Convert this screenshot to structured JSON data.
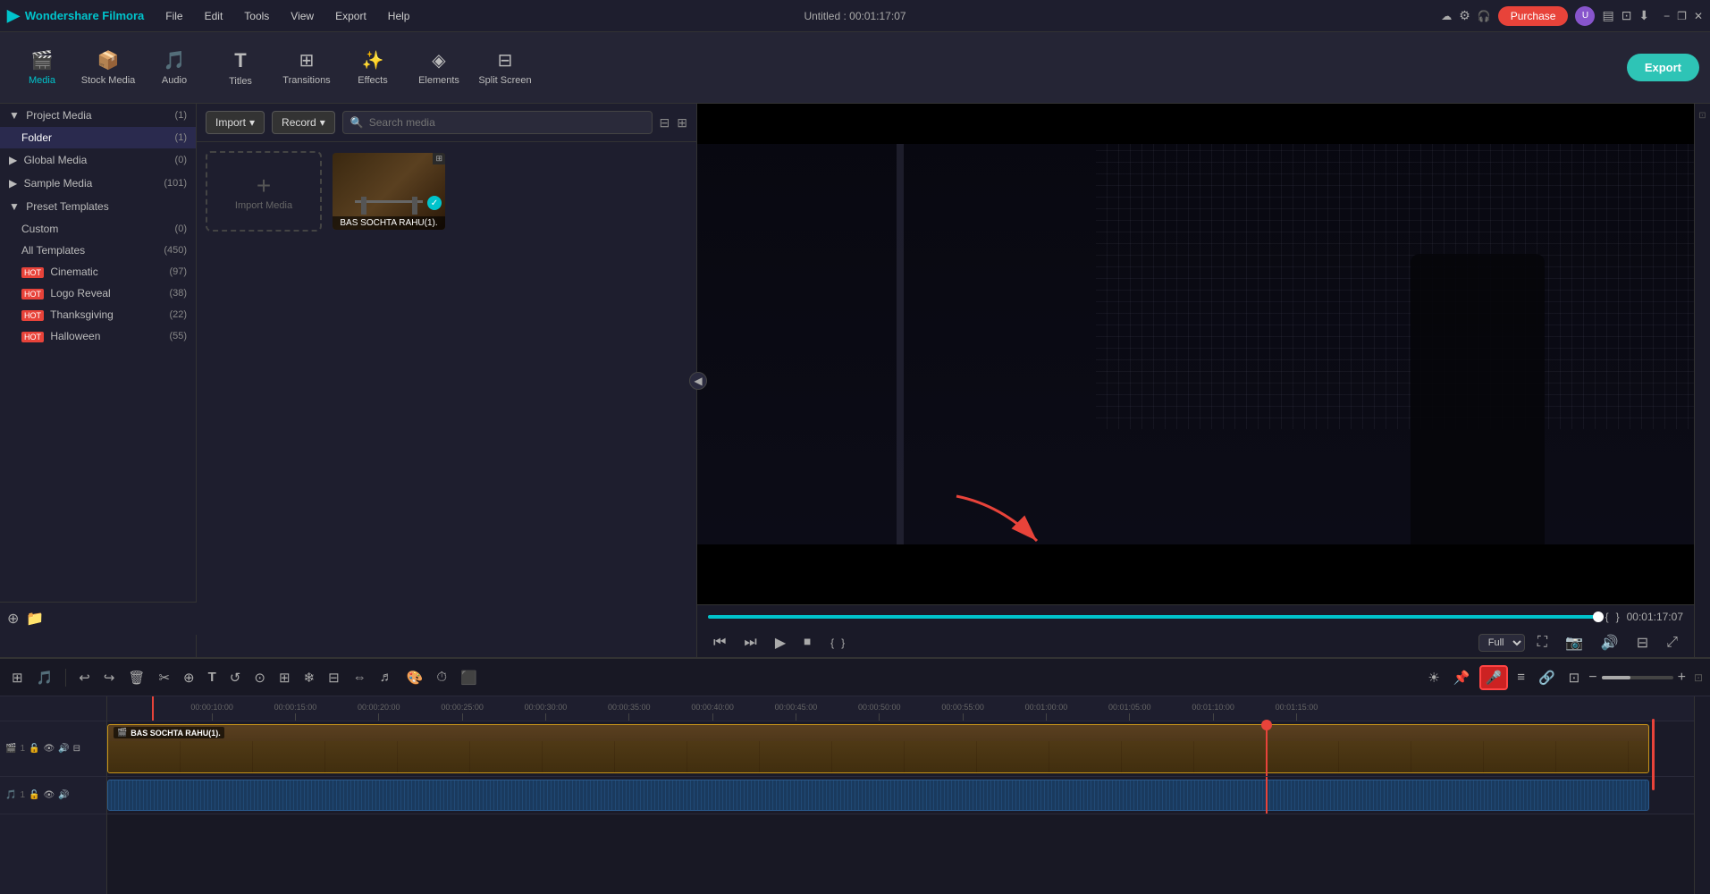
{
  "app": {
    "name": "Wondershare Filmora",
    "title": "Untitled : 00:01:17:07",
    "logo_symbol": "✦"
  },
  "menu": {
    "items": [
      "File",
      "Edit",
      "Tools",
      "View",
      "Export",
      "Help"
    ]
  },
  "titlebar": {
    "cloud_icon": "☁",
    "settings_icon": "⚙",
    "headphone_icon": "🎧",
    "purchase_label": "Purchase",
    "win_minimize": "−",
    "win_restore": "❐",
    "win_close": "✕"
  },
  "toolbar": {
    "items": [
      {
        "id": "media",
        "icon": "🎬",
        "label": "Media",
        "active": true
      },
      {
        "id": "stock",
        "icon": "📦",
        "label": "Stock Media",
        "active": false
      },
      {
        "id": "audio",
        "icon": "🎵",
        "label": "Audio",
        "active": false
      },
      {
        "id": "titles",
        "icon": "T",
        "label": "Titles",
        "active": false
      },
      {
        "id": "transitions",
        "icon": "⊞",
        "label": "Transitions",
        "active": false
      },
      {
        "id": "effects",
        "icon": "✨",
        "label": "Effects",
        "active": false
      },
      {
        "id": "elements",
        "icon": "◈",
        "label": "Elements",
        "active": false
      },
      {
        "id": "splitscreen",
        "icon": "⊟",
        "label": "Split Screen",
        "active": false
      }
    ],
    "export_label": "Export"
  },
  "media_panel": {
    "import_label": "Import",
    "record_label": "Record",
    "search_placeholder": "Search media",
    "filter_icon": "⊟",
    "grid_icon": "⊞",
    "import_placeholder_label": "Import Media",
    "media_items": [
      {
        "id": "bas-sochta",
        "label": "BAS SOCHTA RAHU(1).",
        "has_check": true
      }
    ]
  },
  "sidebar": {
    "sections": [
      {
        "id": "project-media",
        "label": "Project Media",
        "count": 1,
        "expanded": true,
        "children": [
          {
            "id": "folder",
            "label": "Folder",
            "count": 1
          }
        ]
      },
      {
        "id": "global-media",
        "label": "Global Media",
        "count": 0,
        "expanded": false,
        "children": []
      },
      {
        "id": "sample-media",
        "label": "Sample Media",
        "count": 101,
        "expanded": false,
        "children": []
      },
      {
        "id": "preset-templates",
        "label": "Preset Templates",
        "count": null,
        "expanded": true,
        "children": [
          {
            "id": "custom",
            "label": "Custom",
            "count": 0,
            "hot": false
          },
          {
            "id": "all-templates",
            "label": "All Templates",
            "count": 450,
            "hot": false
          },
          {
            "id": "cinematic",
            "label": "Cinematic",
            "count": 97,
            "hot": true
          },
          {
            "id": "logo-reveal",
            "label": "Logo Reveal",
            "count": 38,
            "hot": true
          },
          {
            "id": "thanksgiving",
            "label": "Thanksgiving",
            "count": 22,
            "hot": true
          },
          {
            "id": "halloween",
            "label": "Halloween",
            "count": 55,
            "hot": true
          }
        ]
      }
    ]
  },
  "preview": {
    "progress_percent": 100,
    "time_current": "00:01:17:07",
    "quality": "Full",
    "btn_rewind": "⏮",
    "btn_step_back": "⏭",
    "btn_play": "▶",
    "btn_stop": "⏹",
    "btn_prev_frame": "⟨",
    "btn_next_frame": "⟩"
  },
  "timeline": {
    "ruler_marks": [
      "00:00:10:00",
      "00:00:15:00",
      "00:00:20:00",
      "00:00:25:00",
      "00:00:30:00",
      "00:00:35:00",
      "00:00:40:00",
      "00:00:45:00",
      "00:00:50:00",
      "00:00:55:00",
      "00:01:00:00",
      "00:01:05:00",
      "00:01:10:00",
      "00:01:15:00"
    ],
    "video_track_label": "BAS SOCHTA RAHU(1).",
    "cursor_position_percent": 73
  },
  "timeline_tools": {
    "undo_icon": "↩",
    "redo_icon": "↪",
    "delete_icon": "🗑",
    "cut_icon": "✂",
    "magnet_icon": "⊕",
    "text_icon": "T",
    "refresh_icon": "↺",
    "zoom_in_icon": "+",
    "zoom_out_icon": "−",
    "mic_icon": "🎤"
  },
  "colors": {
    "accent": "#00c4cc",
    "purchase_red": "#e8433a",
    "hot_badge": "#e8433a",
    "timeline_clip": "#c8941a",
    "playhead": "#e8433a"
  }
}
